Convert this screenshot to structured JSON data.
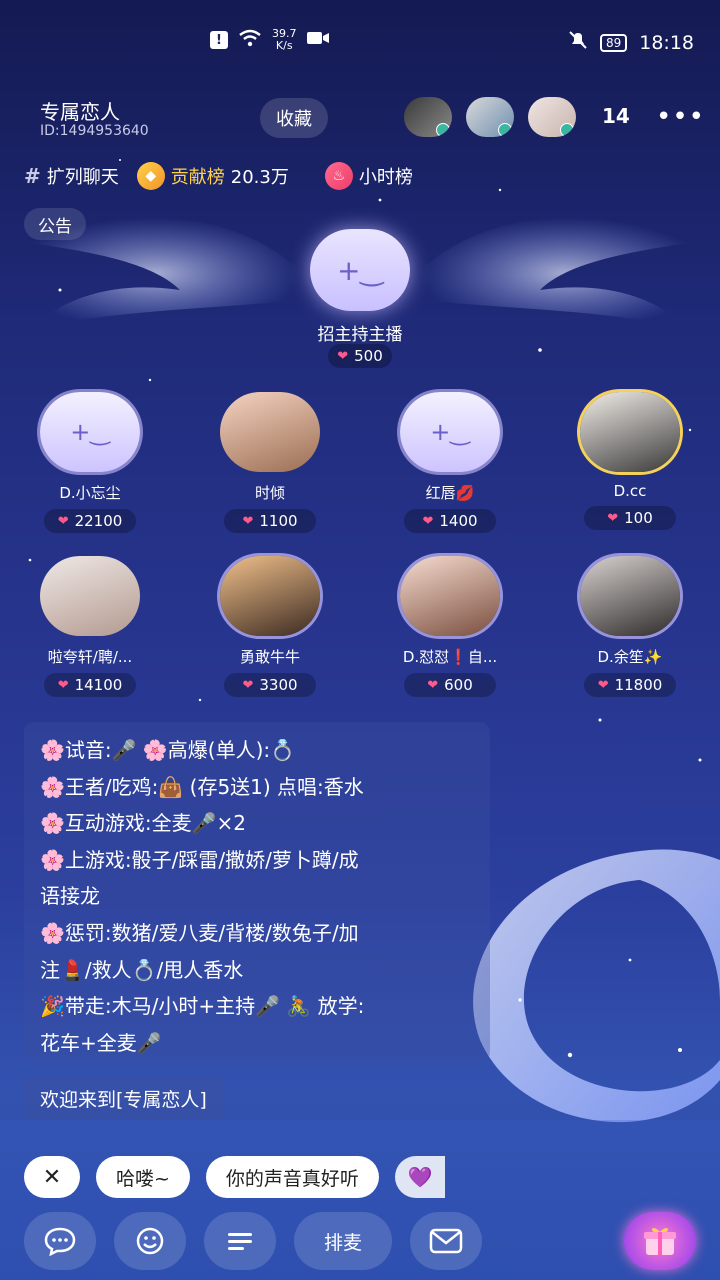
{
  "status_bar": {
    "net_speed_value": "39.7",
    "net_speed_unit": "K/s",
    "battery": "89",
    "time": "18:18"
  },
  "room": {
    "name": "专属恋人",
    "id_label": "ID:1494953640",
    "favorite_label": "收藏",
    "online_count": "14"
  },
  "info": {
    "tag": "扩列聊天",
    "contrib_label": "贡献榜",
    "contrib_value": "20.3万",
    "hourly_label": "小时榜",
    "notice_label": "公告"
  },
  "host": {
    "name": "招主持主播",
    "score": "500"
  },
  "seats": [
    {
      "name": "D.小忘尘",
      "score": "22100",
      "empty": true
    },
    {
      "name": "时倾",
      "score": "1100",
      "empty": false
    },
    {
      "name": "红唇💋",
      "score": "1400",
      "empty": true
    },
    {
      "name": "D.cc",
      "score": "100",
      "empty": false
    },
    {
      "name": "啦夸轩/聘/...",
      "score": "14100",
      "empty": false
    },
    {
      "name": "勇敢牛牛",
      "score": "3300",
      "empty": false
    },
    {
      "name": "D.怼怼❗自...",
      "score": "600",
      "empty": false
    },
    {
      "name": "D.余笙✨",
      "score": "11800",
      "empty": false
    }
  ],
  "announcement": [
    "🌸试音:🎤 🌸高爆(单人):💍",
    "🌸王者/吃鸡:👜 (存5送1) 点唱:香水",
    "🌸互动游戏:全麦🎤×2",
    "🌸上游戏:骰子/踩雷/撒娇/萝卜蹲/成",
    "语接龙",
    "🌸惩罚:数猪/爱八麦/背楼/数兔子/加",
    "注💄/救人💍/甩人香水",
    "🎉带走:木马/小时+主持🎤 🚴 放学:",
    "花车+全麦🎤"
  ],
  "welcome": "欢迎来到[专属恋人]",
  "quick_replies": [
    "哈喽~",
    "你的声音真好听"
  ],
  "bottom": {
    "queue_label": "排麦"
  },
  "colors": {
    "accent_heart": "#ff5a8a",
    "background_top": "#141a52",
    "background_bottom": "#2a4aa8"
  }
}
